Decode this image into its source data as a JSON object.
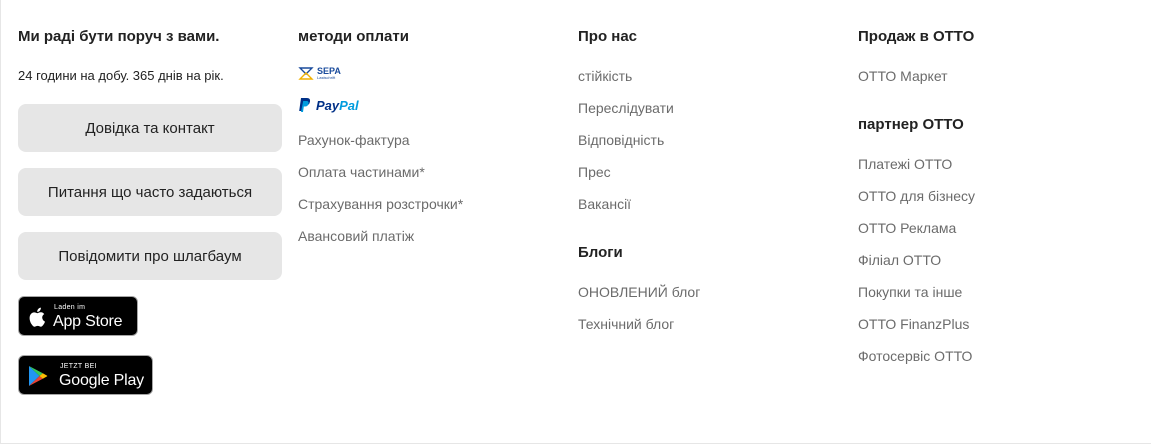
{
  "support": {
    "heading": "Ми раді бути поруч з вами.",
    "hours": "24 години на добу. 365 днів на рік.",
    "buttons": [
      "Довідка та контакт",
      "Питання що часто задаються",
      "Повідомити про шлагбаум"
    ],
    "app_store": {
      "small": "Laden im",
      "big": "App Store"
    },
    "google_play": {
      "small": "JETZT BEI",
      "big": "Google Play"
    }
  },
  "payment": {
    "heading": "методи оплати",
    "sepa_logo": "SEPA",
    "sepa_sub": "Lastschrift",
    "paypal_logo": {
      "pay": "Pay",
      "pal": "Pal"
    },
    "links": [
      "Рахунок-фактура",
      "Оплата частинами*",
      "Страхування розстрочки*",
      "Авансовий платіж"
    ]
  },
  "about": {
    "heading": "Про нас",
    "links": [
      "стійкість",
      "Переслідувати",
      "Відповідність",
      "Прес",
      "Вакансії"
    ],
    "blogs_heading": "Блоги",
    "blog_links": [
      "ОНОВЛЕНИЙ блог",
      "Технічний блог"
    ]
  },
  "sell": {
    "heading": "Продаж в ОТТО",
    "links": [
      "ОТТО Маркет"
    ],
    "partner_heading": "партнер ОТТО",
    "partner_links": [
      "Платежі ОТТО",
      "ОТТО для бізнесу",
      "ОТТО Реклама",
      "Філіал ОТТО",
      "Покупки та інше",
      "ОТТО FinanzPlus",
      "Фотосервіс ОТТО"
    ]
  },
  "colors": {
    "text": "#222222",
    "link": "#6b6b6b",
    "button_bg": "#e6e6e6",
    "badge_bg": "#000000",
    "paypal_dark": "#003087",
    "paypal_light": "#009cde",
    "sepa_blue": "#1a4b9c"
  }
}
